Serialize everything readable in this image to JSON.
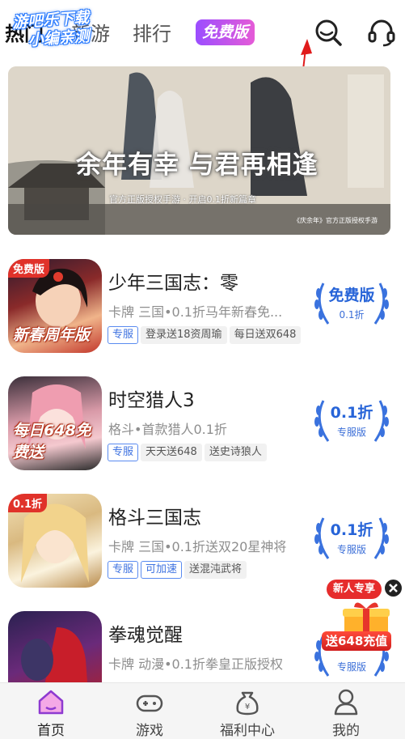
{
  "header": {
    "tabs": [
      {
        "label": "热门",
        "active": true
      },
      {
        "label": "新游",
        "active": false
      },
      {
        "label": "排行",
        "active": false
      },
      {
        "label": "免费版",
        "active": false
      }
    ],
    "watermark_line1": "游吧乐下载",
    "watermark_line2": "小编亲测",
    "icons": [
      "search-icon",
      "headset-icon"
    ]
  },
  "banner": {
    "title": "余年有幸 与君再相逢",
    "subtitle": "官方正版授权手游 · 开启0.1折新篇章",
    "footnote": "《庆余年》官方正版授权手游"
  },
  "games": [
    {
      "name": "少年三国志：零",
      "desc": "卡牌 三国•0.1折马年新春免...",
      "tags": [
        {
          "text": "专服",
          "style": "blue"
        },
        {
          "text": "登录送18资周瑜",
          "style": "gray"
        },
        {
          "text": "每日送双648",
          "style": "gray"
        }
      ],
      "badge_main": "免费版",
      "badge_sub": "0.1折",
      "icon_corner": "免费版",
      "icon_caption": "新春周年版"
    },
    {
      "name": "时空猎人3",
      "desc": "格斗•首款猎人0.1折",
      "tags": [
        {
          "text": "专服",
          "style": "blue"
        },
        {
          "text": "天天送648",
          "style": "gray"
        },
        {
          "text": "送史诗狼人",
          "style": "gray"
        }
      ],
      "badge_main": "0.1折",
      "badge_sub": "专服版",
      "icon_corner": "",
      "icon_caption": "每日648免费送"
    },
    {
      "name": "格斗三国志",
      "desc": "卡牌 三国•0.1折送双20星神将",
      "tags": [
        {
          "text": "专服",
          "style": "blue"
        },
        {
          "text": "可加速",
          "style": "blue"
        },
        {
          "text": "送混沌武将",
          "style": "gray"
        }
      ],
      "badge_main": "0.1折",
      "badge_sub": "专服版",
      "icon_corner": "0.1折",
      "icon_caption": ""
    },
    {
      "name": "拳魂觉醒",
      "desc": "卡牌 动漫•0.1折拳皇正版授权",
      "tags": [],
      "badge_main": "",
      "badge_sub": "专服版",
      "icon_corner": "",
      "icon_caption": ""
    }
  ],
  "promo": {
    "head": "新人专享",
    "amount": "送648充值",
    "icons": [
      "close-icon",
      "gift-icon"
    ]
  },
  "bottom_nav": [
    {
      "label": "首页",
      "icon": "home-icon",
      "active": true
    },
    {
      "label": "游戏",
      "icon": "gamepad-icon",
      "active": false
    },
    {
      "label": "福利中心",
      "icon": "money-bag-icon",
      "active": false
    },
    {
      "label": "我的",
      "icon": "user-icon",
      "active": false
    }
  ],
  "colors": {
    "accent_blue": "#2764d8",
    "free_purple": "#9b4dff",
    "promo_red": "#e62c2c"
  }
}
